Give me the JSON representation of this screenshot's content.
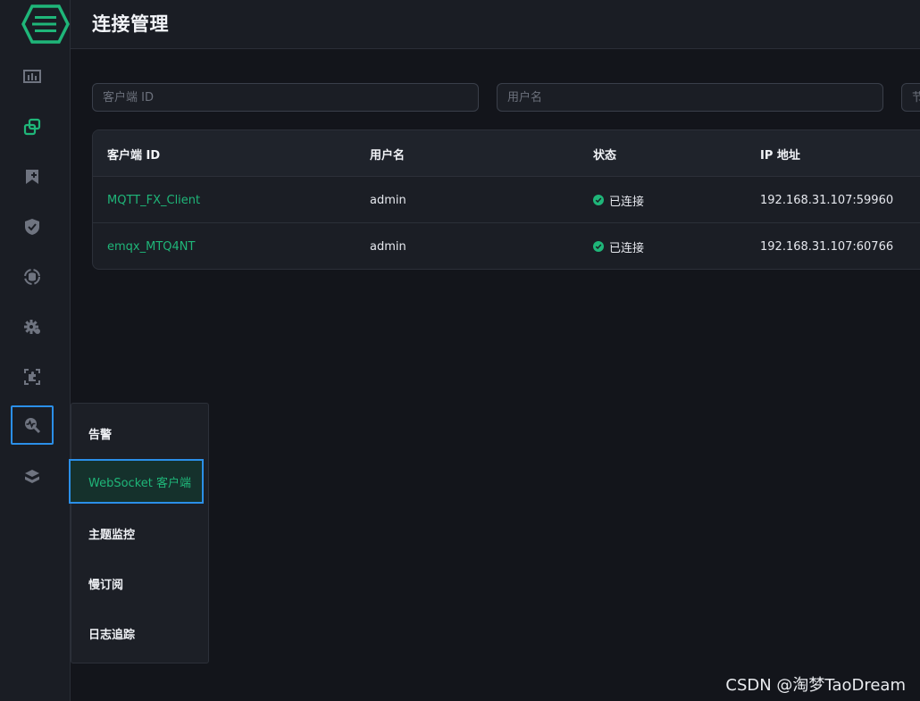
{
  "header": {
    "title": "连接管理"
  },
  "filters": {
    "client_id_placeholder": "客户端 ID",
    "username_placeholder": "用户名",
    "node_placeholder": "节"
  },
  "table": {
    "columns": [
      "客户端 ID",
      "用户名",
      "状态",
      "IP 地址"
    ],
    "rows": [
      {
        "client_id": "MQTT_FX_Client",
        "username": "admin",
        "status": "已连接",
        "ip": "192.168.31.107:59960"
      },
      {
        "client_id": "emqx_MTQ4NT",
        "username": "admin",
        "status": "已连接",
        "ip": "192.168.31.107:60766"
      }
    ]
  },
  "sidebar": {
    "items": [
      {
        "icon": "dashboard-icon"
      },
      {
        "icon": "connections-icon"
      },
      {
        "icon": "subscription-icon"
      },
      {
        "icon": "shield-icon"
      },
      {
        "icon": "data-integration-icon"
      },
      {
        "icon": "gear-icon"
      },
      {
        "icon": "extension-icon"
      },
      {
        "icon": "diagnose-icon"
      },
      {
        "icon": "layers-icon"
      }
    ]
  },
  "submenu": {
    "items": [
      "告警",
      "WebSocket 客户端",
      "主题监控",
      "慢订阅",
      "日志追踪"
    ]
  },
  "watermark": "CSDN @淘梦TaoDream",
  "colors": {
    "accent": "#1fb679",
    "highlight_border": "#2b8fe8",
    "background": "#13151b"
  }
}
